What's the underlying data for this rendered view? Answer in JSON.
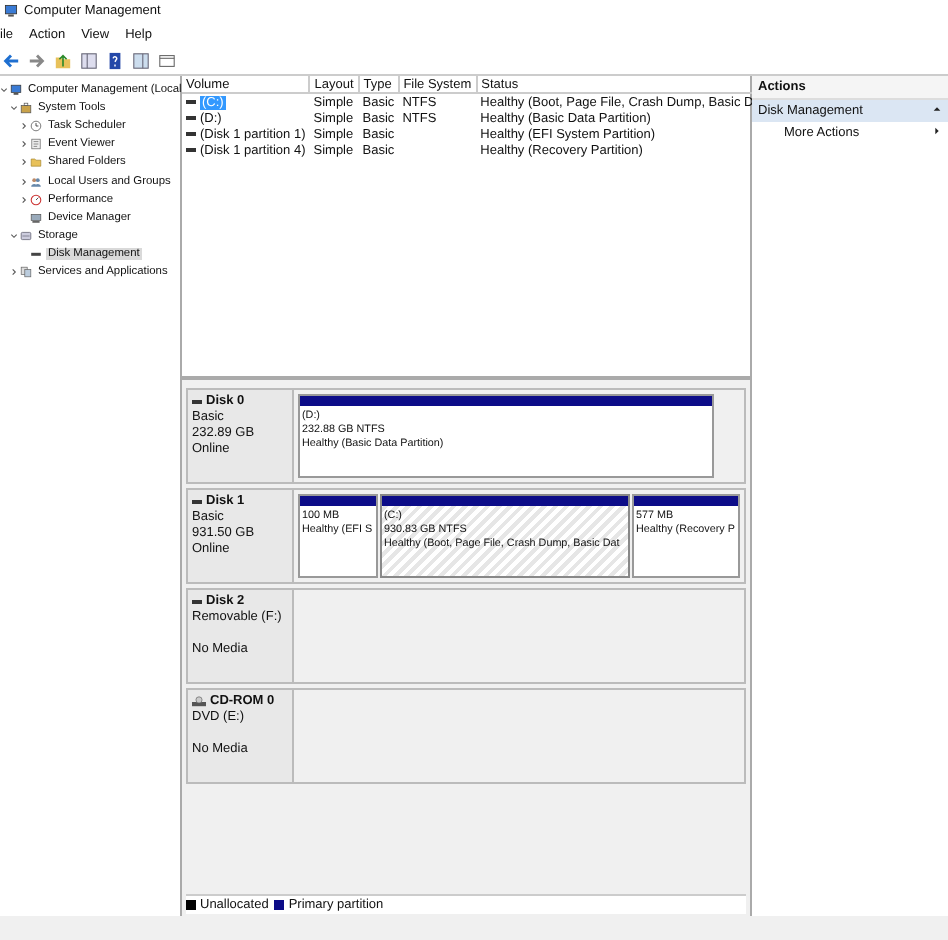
{
  "window": {
    "title": "Computer Management"
  },
  "menu": [
    "ile",
    "Action",
    "View",
    "Help"
  ],
  "tree": [
    {
      "label": "Computer Management (Local",
      "expanded": true,
      "selected": false,
      "children": [
        {
          "label": "System Tools",
          "expanded": true,
          "selected": false,
          "children": [
            {
              "label": "Task Scheduler",
              "expanded": false,
              "selected": false
            },
            {
              "label": "Event Viewer",
              "expanded": false,
              "selected": false
            },
            {
              "label": "Shared Folders",
              "expanded": false,
              "selected": false
            },
            {
              "label": "Local Users and Groups",
              "expanded": false,
              "selected": false
            },
            {
              "label": "Performance",
              "expanded": false,
              "selected": false
            },
            {
              "label": "Device Manager",
              "selected": false
            }
          ]
        },
        {
          "label": "Storage",
          "expanded": true,
          "selected": false,
          "children": [
            {
              "label": "Disk Management",
              "selected": true
            }
          ]
        },
        {
          "label": "Services and Applications",
          "expanded": false,
          "selected": false
        }
      ]
    }
  ],
  "volumes": {
    "columns": [
      "Volume",
      "Layout",
      "Type",
      "File System",
      "Status"
    ],
    "rows": [
      {
        "cells": [
          "(C:)",
          "Simple",
          "Basic",
          "NTFS",
          "Healthy (Boot, Page File, Crash Dump, Basic D"
        ],
        "selected": true
      },
      {
        "cells": [
          "(D:)",
          "Simple",
          "Basic",
          "NTFS",
          "Healthy (Basic Data Partition)"
        ],
        "selected": false
      },
      {
        "cells": [
          "(Disk 1 partition 1)",
          "Simple",
          "Basic",
          null,
          "Healthy (EFI System Partition)"
        ],
        "selected": false
      },
      {
        "cells": [
          "(Disk 1 partition 4)",
          "Simple",
          "Basic",
          null,
          "Healthy (Recovery Partition)"
        ],
        "selected": false
      }
    ]
  },
  "disks": [
    {
      "name": "Disk 0",
      "kind": "disk",
      "lines": [
        "Basic",
        "232.89 GB"
      ],
      "status": "Online",
      "partitions": [
        {
          "lines": [
            "(D:)",
            "232.88 GB NTFS",
            "Healthy (Basic Data Partition)"
          ],
          "selected": false
        }
      ]
    },
    {
      "name": "Disk 1",
      "kind": "disk",
      "lines": [
        "Basic",
        "931.50 GB"
      ],
      "status": "Online",
      "partitions": [
        {
          "lines": [
            "100 MB",
            "Healthy (EFI S"
          ],
          "selected": false
        },
        {
          "lines": [
            "(C:)",
            "930.83 GB NTFS",
            "Healthy (Boot, Page File, Crash Dump, Basic Dat"
          ],
          "selected": true
        },
        {
          "lines": [
            "577 MB",
            "Healthy (Recovery P"
          ],
          "selected": false
        }
      ]
    },
    {
      "name": "Disk 2",
      "kind": "disk",
      "lines": [
        "Removable (F:)"
      ],
      "status": "No Media"
    },
    {
      "name": "CD-ROM 0",
      "kind": "cdrom",
      "lines": [
        "DVD (E:)"
      ],
      "status": "No Media"
    }
  ],
  "legend": [
    {
      "label": "Unallocated",
      "color": "#000000"
    },
    {
      "label": "Primary partition",
      "color": "#0c0c88"
    }
  ],
  "actions": {
    "header": "Actions",
    "sections": [
      {
        "title": "Disk Management",
        "items": [
          "More Actions"
        ]
      }
    ]
  }
}
